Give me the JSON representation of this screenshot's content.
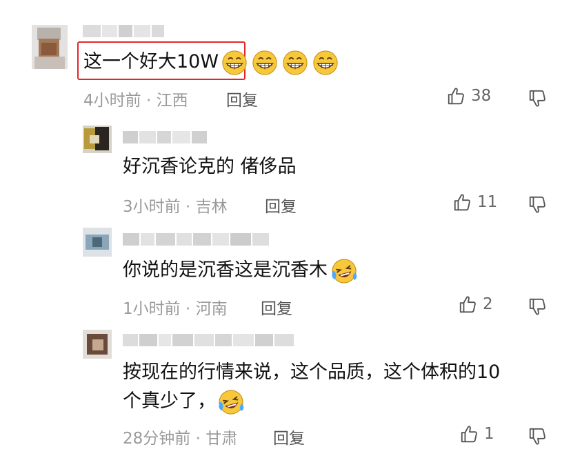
{
  "comments": [
    {
      "text": "这一个好大10W",
      "emoji": [
        "grin",
        "grin",
        "grin",
        "grin"
      ],
      "time_location": "4小时前 · 江西",
      "reply_label": "回复",
      "likes": "38"
    },
    {
      "text": "好沉香论克的  偖侈品",
      "time_location": "3小时前 · 吉林",
      "reply_label": "回复",
      "likes": "11"
    },
    {
      "text": "你说的是沉香这是沉香木",
      "emoji": [
        "laugh-cry"
      ],
      "time_location": "1小时前 · 河南",
      "reply_label": "回复",
      "likes": "2"
    },
    {
      "text_line1": "按现在的行情来说，这个品质，这个体积的10",
      "text_line2": "个真少了，",
      "emoji": [
        "laugh-cry"
      ],
      "time_location": "28分钟前 · 甘肃",
      "reply_label": "回复",
      "likes": "1"
    }
  ],
  "colors": {
    "highlight": "#e4262b",
    "meta": "#9a9a9a",
    "text": "#111111"
  },
  "icons": [
    "thumbs-up-icon",
    "thumbs-down-icon",
    "grin-emoji-icon",
    "laugh-cry-emoji-icon"
  ]
}
